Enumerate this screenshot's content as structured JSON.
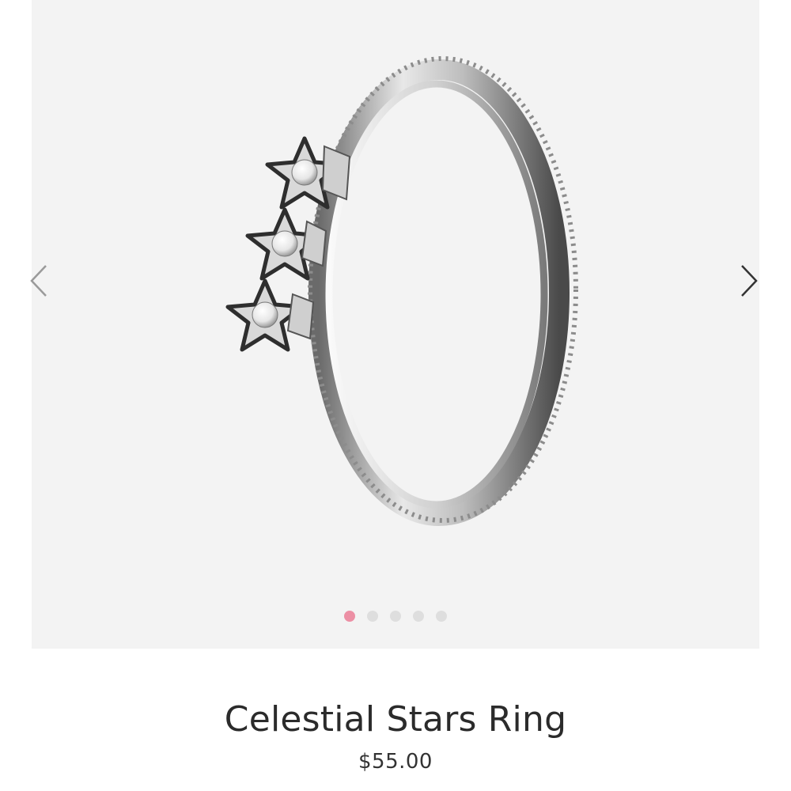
{
  "carousel": {
    "total_images": 5,
    "active_index": 0,
    "prev_icon": "chevron-left-icon",
    "next_icon": "chevron-right-icon",
    "active_dot_color": "#ec8fa4",
    "inactive_dot_color": "#dedede",
    "background_color": "#f3f3f3"
  },
  "product": {
    "name": "Celestial Stars Ring",
    "price": "$55.00"
  }
}
